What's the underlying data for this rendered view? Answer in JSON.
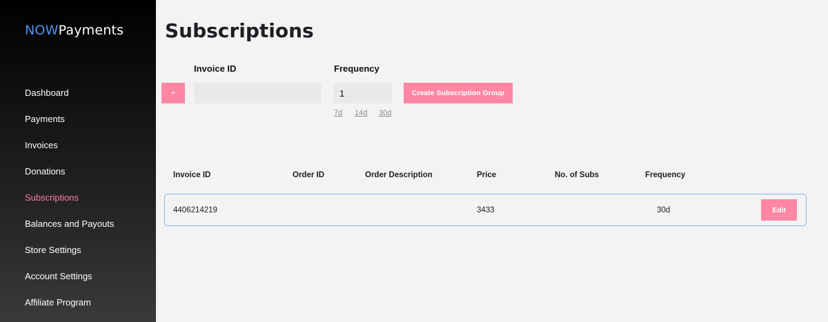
{
  "brand": {
    "part1": "NOW",
    "part2": "Payments",
    "accent_color": "#4f8ff0"
  },
  "sidebar": {
    "items": [
      {
        "label": "Dashboard",
        "active": false
      },
      {
        "label": "Payments",
        "active": false
      },
      {
        "label": "Invoices",
        "active": false
      },
      {
        "label": "Donations",
        "active": false
      },
      {
        "label": "Subscriptions",
        "active": true
      },
      {
        "label": "Balances and Payouts",
        "active": false
      },
      {
        "label": "Store Settings",
        "active": false
      },
      {
        "label": "Account Settings",
        "active": false
      },
      {
        "label": "Affiliate Program",
        "active": false
      }
    ],
    "active_color": "#ff7f9f"
  },
  "page": {
    "title": "Subscriptions"
  },
  "form": {
    "add_label": "+",
    "invoice_label": "Invoice ID",
    "invoice_value": "",
    "frequency_label": "Frequency",
    "frequency_value": "1",
    "create_label": "Create Subscription Group",
    "presets": [
      "7d",
      "14d",
      "30d"
    ]
  },
  "table": {
    "headers": {
      "invoice_id": "Invoice ID",
      "order_id": "Order ID",
      "order_description": "Order Description",
      "price": "Price",
      "subs": "No. of Subs",
      "frequency": "Frequency"
    },
    "rows": [
      {
        "invoice_id": "4406214219",
        "order_id": "",
        "order_description": "",
        "price": "3433",
        "subs": "",
        "frequency": "30d",
        "action_label": "Edit"
      }
    ]
  },
  "colors": {
    "pink_button": "#ff87a4",
    "row_border": "#7fb3ef"
  }
}
